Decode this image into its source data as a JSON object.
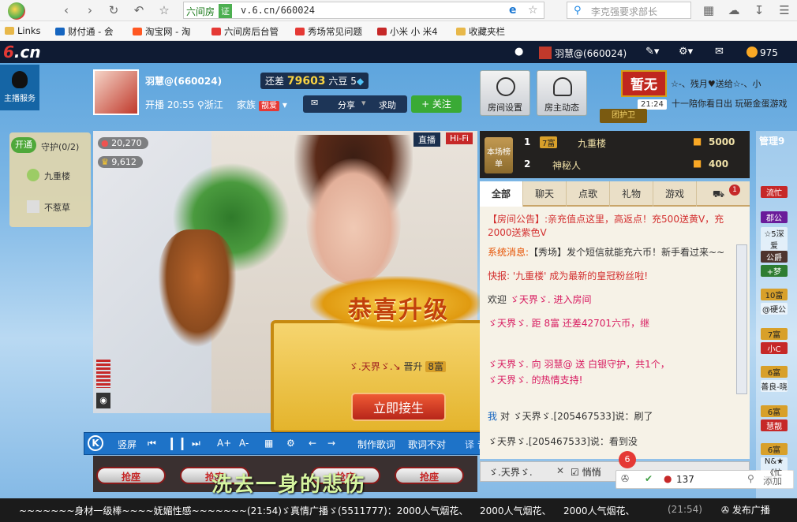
{
  "browser": {
    "site_name": "六间房",
    "cert": "证",
    "url": "v.6.cn/660024",
    "search_placeholder": "李克强要求部长",
    "bookmarks": [
      "Links",
      "财付通 - 会",
      "淘宝网 - 淘",
      "六间房后台管",
      "秀场常见问题",
      "小米 小 米4",
      "收藏夹栏"
    ]
  },
  "site_nav": {
    "logo_main": "6",
    "logo_suffix": ".cn",
    "user": "羽慧@(660024)",
    "coins": "975"
  },
  "anchor": {
    "service_label": "主播服务",
    "name": "羽慧@(660024)",
    "diff_prefix": "还差",
    "diff_value": "79603",
    "diff_suffix": "六豆 5",
    "live_time": "开播 20:55",
    "location": "浙江",
    "family_label": "家族",
    "family_tag": "靓爱",
    "actions": [
      "分享",
      "求助"
    ],
    "follow_label": "+ 关注",
    "room_settings": "房间设置",
    "host_dynamic": "房主动态",
    "zanwu": "暂无",
    "time_box": "21:24",
    "marquee1": "☆-、残月♥送给☆-、小",
    "marquee2": "十一陪你看日出 玩砸金蛋游戏",
    "guard_team": "团护卫"
  },
  "guard": {
    "tab": "开通",
    "title": "守护(0/2)",
    "items": [
      "九重楼",
      "不惹草"
    ]
  },
  "video": {
    "badge_live": "直播",
    "badge_hifi": "Hi-Fi",
    "wealth": "20,270",
    "stars": "9,612"
  },
  "popup": {
    "title": "恭喜升级",
    "user": "ゞ.天界ゞ.↘",
    "action": "晋升",
    "level": "8富",
    "button": "立即接生"
  },
  "player": {
    "vertical": "竖屏",
    "make_lyrics": "制作歌词",
    "lyrics_wrong": "歌词不对",
    "translate": "译 音",
    "lyrics_line": "洗去一身的悲伤"
  },
  "seats": [
    "抢座",
    "抢座",
    "抢座",
    "抢座"
  ],
  "rank": {
    "badge": "本场榜单",
    "rows": [
      {
        "n": "1",
        "lv": "7富",
        "name": "九重楼",
        "pts": "5000"
      },
      {
        "n": "2",
        "lv": "",
        "name": "神秘人",
        "pts": "400"
      }
    ]
  },
  "chat": {
    "tabs": [
      "全部",
      "聊天",
      "点歌",
      "礼物",
      "游戏"
    ],
    "tab_badge": "1",
    "messages": [
      {
        "label": "【房间公告】:",
        "text": "亲充值点这里，高返点！充500送黄V，充2000送紫色V"
      },
      {
        "label": "系统消息:",
        "text": "【秀场】发个短信就能充六币！新手看过来~~"
      },
      {
        "label": "快报:",
        "text": "'九重楼' 成为最新的皇冠粉丝啦!"
      },
      {
        "label": "欢迎",
        "text": "ゞ天界ゞ. 进入房间"
      },
      {
        "label": "",
        "text": "ゞ天界ゞ. 距 8富 还差42701六币，继"
      },
      {
        "label": "",
        "text": "ゞ天界ゞ. 向 羽慧@ 送 白银守护，共1个，"
      },
      {
        "label": "",
        "text": "ゞ天界ゞ. 的热情支持!"
      },
      {
        "label": "我",
        "text": "对 ゞ天界ゞ.[205467533]说：刷了"
      },
      {
        "label": "",
        "text": "ゞ天界ゞ.[205467533]说：看到没"
      }
    ],
    "input_target": "ゞ.天界ゞ.",
    "private_label": "悄悄",
    "online_count": "137",
    "add_label": "添加",
    "notif_count": "6"
  },
  "right": {
    "title": "管理9",
    "tags": [
      "流忙",
      "郡公",
      "☆5深爱",
      "公爵",
      "+梦",
      "10富",
      "@硬公",
      "7富",
      "小C",
      "6富",
      "善良-晓",
      "6富",
      "慧靓",
      "6富",
      "N&★《忙"
    ]
  },
  "ticker": {
    "items": [
      "~~~~~~~身材一级棒~~~~妩媚性感~~~~~~~(21:54)",
      "ゞ真情广播ゞ(5511777)：2000人气烟花、",
      "2000人气烟花、",
      "2000人气烟花、",
      "(21:54)"
    ],
    "publish": "发布广播"
  }
}
